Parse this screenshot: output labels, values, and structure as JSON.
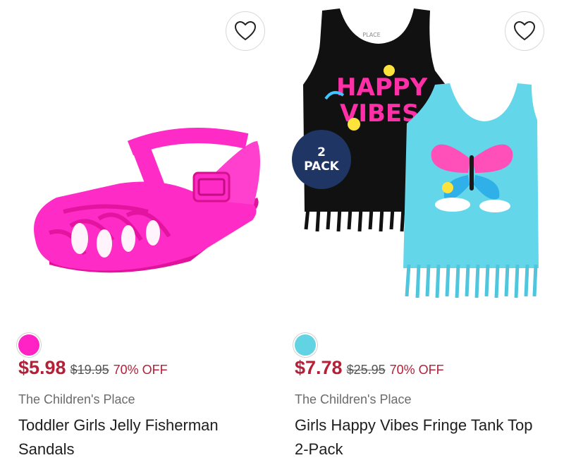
{
  "products": [
    {
      "swatch_color": "#ff22c4",
      "sale_price": "$5.98",
      "original_price": "$19.95",
      "discount": "70% OFF",
      "brand": "The Children's Place",
      "name": "Toddler Girls Jelly Fisherman Sandals",
      "favorite_icon": "heart-outline-icon"
    },
    {
      "swatch_color": "#62d3e3",
      "sale_price": "$7.78",
      "original_price": "$25.95",
      "discount": "70% OFF",
      "brand": "The Children's Place",
      "name": "Girls Happy Vibes Fringe Tank Top 2-Pack",
      "favorite_icon": "heart-outline-icon",
      "badge": {
        "line1": "2",
        "line2": "PACK"
      },
      "graphic_text": {
        "happy": "HAPPY",
        "vibes": "VIBES",
        "place": "PLACE"
      }
    }
  ],
  "colors": {
    "sale": "#b51f37",
    "pack_badge": "#1f3563"
  }
}
